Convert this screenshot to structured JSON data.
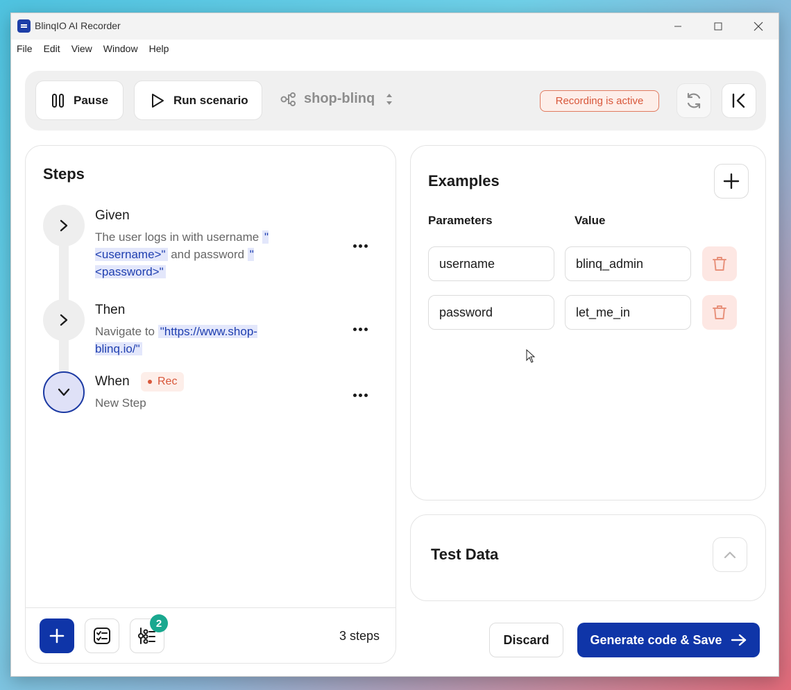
{
  "window": {
    "title": "BlinqIO AI Recorder",
    "controls": [
      "minimize-icon",
      "maximize-icon",
      "close-icon"
    ]
  },
  "menu": [
    "File",
    "Edit",
    "View",
    "Window",
    "Help"
  ],
  "toolbar": {
    "pause_label": "Pause",
    "run_label": "Run scenario",
    "project_name": "shop-blinq",
    "recording_status": "Recording is active"
  },
  "steps": {
    "title": "Steps",
    "items": [
      {
        "keyword": "Given",
        "text_parts": [
          "The user logs in with username ",
          "\"<username>\"",
          " and password ",
          "\"<password>\""
        ]
      },
      {
        "keyword": "Then",
        "text_parts": [
          "Navigate to ",
          "\"https://www.shop-blinq.io/\""
        ]
      },
      {
        "keyword": "When",
        "badge": "Rec",
        "text": "New Step"
      }
    ],
    "notifications_count": "2",
    "count_label": "3 steps"
  },
  "examples": {
    "title": "Examples",
    "headers": {
      "parameters": "Parameters",
      "value": "Value"
    },
    "rows": [
      {
        "parameter": "username",
        "value": "blinq_admin"
      },
      {
        "parameter": "password",
        "value": "let_me_in"
      }
    ]
  },
  "test_data": {
    "title": "Test Data"
  },
  "footer": {
    "discard_label": "Discard",
    "generate_label": "Generate code & Save"
  },
  "colors": {
    "primary": "#0f35a8",
    "recording": "#d8573a",
    "badge": "#19a88f",
    "param_highlight": "#e3e7fb"
  }
}
